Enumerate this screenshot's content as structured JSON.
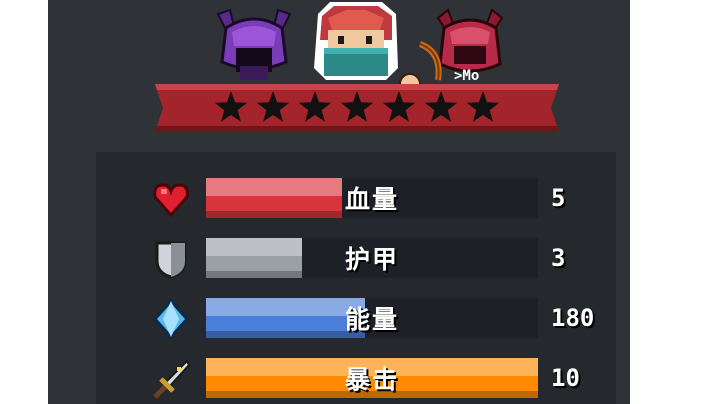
{
  "characters": [
    {
      "name": "purple-horned-helmet-character",
      "selected": false
    },
    {
      "name": "red-hair-bandana-hero",
      "selected": true
    },
    {
      "name": "red-horned-demon-character",
      "selected": false
    }
  ],
  "rating": {
    "stars": 7,
    "filled": 7
  },
  "stats": [
    {
      "id": "hp",
      "label": "血量",
      "value": "5",
      "fill": 0.41,
      "color": "#d8343c",
      "icon": "heart-icon"
    },
    {
      "id": "armor",
      "label": "护甲",
      "value": "3",
      "fill": 0.29,
      "color": "#9aa0a6",
      "icon": "shield-icon"
    },
    {
      "id": "energy",
      "label": "能量",
      "value": "180",
      "fill": 0.48,
      "color": "#4a7ed8",
      "icon": "energy-crystal-icon"
    },
    {
      "id": "crit",
      "label": "暴击",
      "value": "10",
      "fill": 1.0,
      "color": "#ff8a00",
      "icon": "sword-icon"
    }
  ],
  "colors": {
    "panel": "#2f3236",
    "stats_bg": "#25282c",
    "banner": "#a3242b",
    "track": "#1d2026"
  }
}
